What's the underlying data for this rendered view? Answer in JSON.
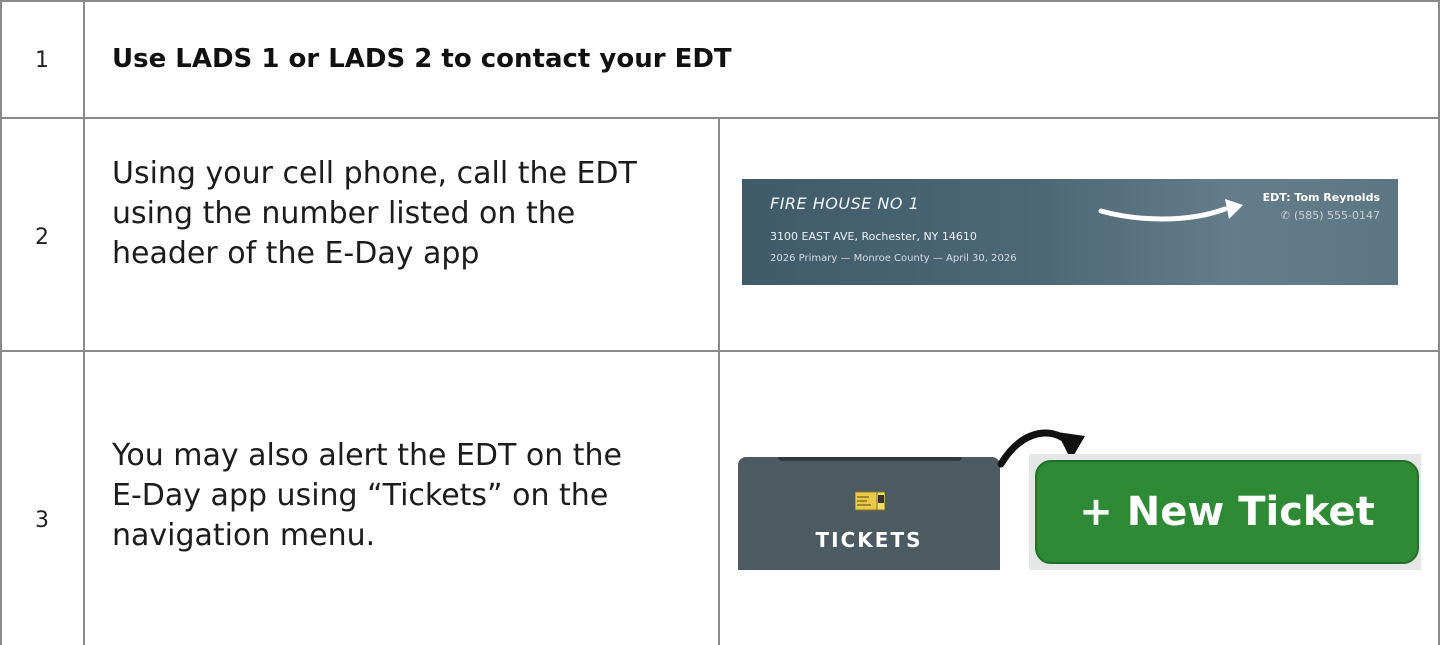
{
  "rows": [
    {
      "number": "1",
      "text": "Use LADS 1 or LADS 2 to contact your EDT"
    },
    {
      "number": "2",
      "text_lines": [
        "Using your cell phone, call the EDT",
        "using the number listed on the",
        "header of the E-Day app"
      ]
    },
    {
      "number": "3",
      "text_lines": [
        "You may also alert the EDT on the",
        "E-Day app using “Tickets” on the",
        "navigation menu."
      ]
    }
  ],
  "header_banner": {
    "location": "FIRE HOUSE NO 1",
    "address": "3100 EAST AVE, Rochester, NY 14610",
    "election": "2026 Primary — Monroe County — April 30, 2026",
    "edt_label": "EDT: Tom Reynolds",
    "edt_phone": "(585) 555-0147",
    "icon": "phone-icon"
  },
  "nav": {
    "tickets_label": "TICKETS",
    "icon": "ticket-icon",
    "tile_color": "#4c5b62"
  },
  "new_ticket_button": {
    "label": "+ New Ticket",
    "color": "#2e8a34"
  }
}
